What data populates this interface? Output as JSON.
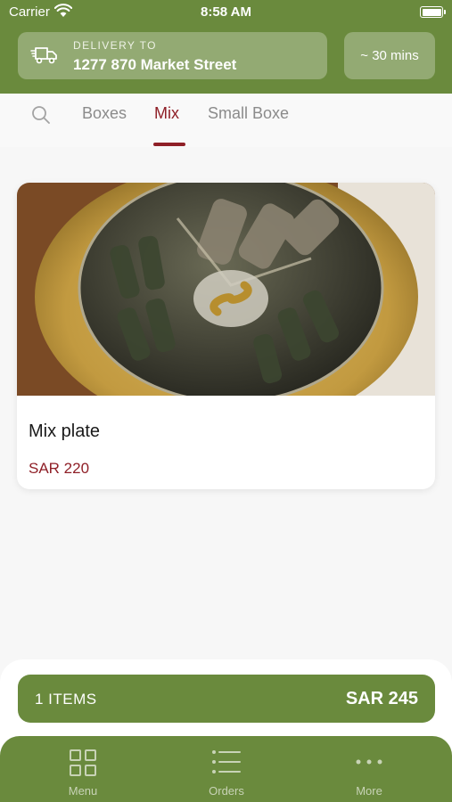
{
  "status_bar": {
    "carrier": "Carrier",
    "time": "8:58 AM"
  },
  "header": {
    "delivery_label": "DELIVERY TO",
    "delivery_address": "1277 870 Market Street",
    "eta": "~ 30 mins"
  },
  "tabs": [
    {
      "label": "Boxes",
      "active": false
    },
    {
      "label": "Mix",
      "active": true
    },
    {
      "label": "Small Boxe",
      "active": false
    }
  ],
  "product": {
    "title": "Mix plate",
    "price": "SAR 220"
  },
  "cart": {
    "count": "1 ITEMS",
    "total": "SAR 245"
  },
  "tabbar": [
    {
      "label": "Menu",
      "icon": "grid-icon"
    },
    {
      "label": "Orders",
      "icon": "list-icon"
    },
    {
      "label": "More",
      "icon": "more-icon"
    }
  ],
  "colors": {
    "brand_green": "#6a8a3d",
    "accent_red": "#8f1f27"
  }
}
